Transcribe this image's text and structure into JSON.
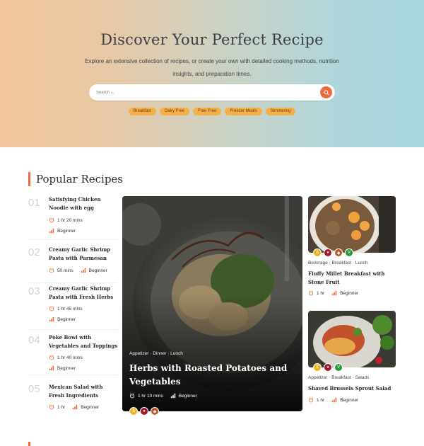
{
  "hero": {
    "title": "Discover Your Perfect Recipe",
    "description": "Explore an extensive collection of recipes, or create your own with detailed cooking methods, nutrition insights, and preparation times.",
    "search_placeholder": "Search ...",
    "tags": [
      "Breakfast",
      "Dairy Free",
      "Free Free",
      "Freezer Meals",
      "Simmering"
    ]
  },
  "popular": {
    "heading": "Popular Recipes",
    "list": [
      {
        "num": "01",
        "title": "Satisfying Chicken Noodle with egg",
        "time": "1 hr 20 mins",
        "level": "Beginner"
      },
      {
        "num": "02",
        "title": "Creamy Garlic Shrimp Pasta with Parmesan",
        "time": "50 mins",
        "level": "Beginner"
      },
      {
        "num": "03",
        "title": "Creamy Garlic Shrimp Pasta with Fresh Herbs",
        "time": "1 hr 45 mins",
        "level": "Beginner"
      },
      {
        "num": "04",
        "title": "Poke Bowl with Vegetables and Toppings",
        "time": "1 hr 40 mins",
        "level": "Beginner"
      },
      {
        "num": "05",
        "title": "Mexican Salad with Fresh Ingredients",
        "time": "1 hr",
        "level": "Beginner"
      }
    ],
    "featured": {
      "categories": "Appetizer · Dinner · Lunch",
      "title": "Herbs with Roasted Potatoes and Vegetables",
      "time": "1 hr 10 mins",
      "level": "Beginner"
    },
    "cards": [
      {
        "categories": "Beverage · Breakfast · Lunch",
        "title": "Fluffy Millet Breakfast with Stone Fruit",
        "time": "1 hr",
        "level": "Beginner"
      },
      {
        "categories": "Appetizer · Breakfast · Salads",
        "title": "Shaved Brussels Sprout Salad",
        "time": "1 hr",
        "level": "Beginner"
      }
    ]
  },
  "colors": {
    "accent": "#ee6a3d",
    "tag": "#f6b04a"
  }
}
